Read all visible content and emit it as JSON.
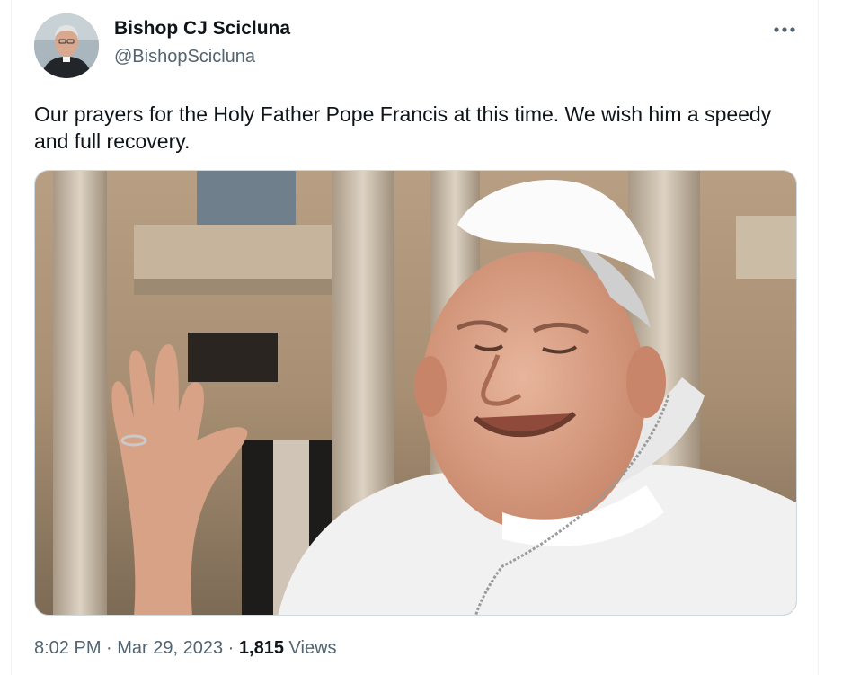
{
  "tweet": {
    "author": {
      "name": "Bishop CJ Scicluna",
      "handle": "@BishopScicluna"
    },
    "text": "Our prayers for the Holy Father Pope Francis at this time. We wish him a speedy and full recovery.",
    "more_icon": "more-horizontal-icon",
    "meta": {
      "time": "8:02 PM",
      "separator1": " · ",
      "date": "Mar 29, 2023",
      "separator2": " · ",
      "views_count": "1,815",
      "views_label": " Views"
    }
  },
  "colors": {
    "text_primary": "#0f1419",
    "text_secondary": "#536471",
    "border": "#cfd9de"
  }
}
